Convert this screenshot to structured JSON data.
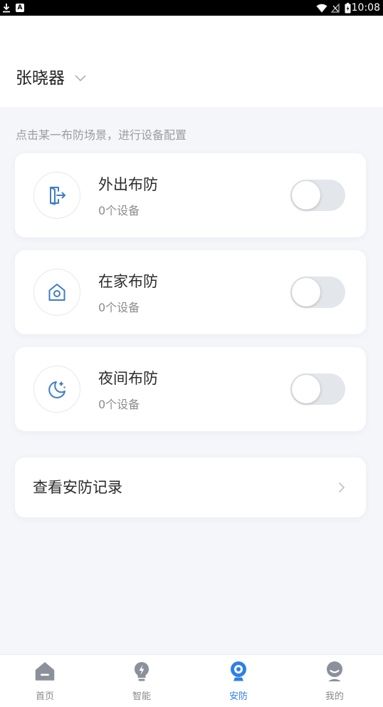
{
  "theme": {
    "accent": "#2d7fe8",
    "icon_blue": "#3f7cc7",
    "background": "#f4f6fa"
  },
  "status_bar": {
    "notification_letter": "A",
    "time": "10:08",
    "icons": [
      "download-icon",
      "notification-icon",
      "wifi-icon",
      "signal-off-icon",
      "battery-icon"
    ]
  },
  "header": {
    "home_name": "张晓器",
    "dropdown_icon": "chevron-down-icon"
  },
  "hint": "点击某一布防场景，进行设备配置",
  "scenes": [
    {
      "name": "外出布防",
      "device_count": "0个设备",
      "icon": "door-exit-icon",
      "enabled": false
    },
    {
      "name": "在家布防",
      "device_count": "0个设备",
      "icon": "home-icon",
      "enabled": false
    },
    {
      "name": "夜间布防",
      "device_count": "0个设备",
      "icon": "moon-icon",
      "enabled": false
    }
  ],
  "record": {
    "label": "查看安防记录",
    "icon": "chevron-right-icon"
  },
  "tabbar": {
    "items": [
      {
        "label": "首页",
        "icon": "home-tab-icon",
        "active": false
      },
      {
        "label": "智能",
        "icon": "bulb-icon",
        "active": false
      },
      {
        "label": "安防",
        "icon": "camera-icon",
        "active": true
      },
      {
        "label": "我的",
        "icon": "user-icon",
        "active": false
      }
    ]
  }
}
